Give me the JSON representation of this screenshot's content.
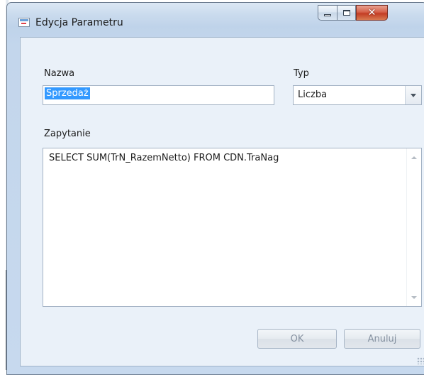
{
  "window": {
    "title": "Edycja Parametru",
    "buttons": {
      "minimize_icon": "minimize-icon",
      "maximize_icon": "maximize-icon",
      "close_icon": "close-icon"
    }
  },
  "form": {
    "name_label": "Nazwa",
    "name_value": "Sprzedaż",
    "type_label": "Typ",
    "type_value": "Liczba",
    "query_label": "Zapytanie",
    "query_value": "SELECT SUM(TrN_RazemNetto) FROM CDN.TraNag"
  },
  "actions": {
    "ok_label": "OK",
    "cancel_label": "Anuluj"
  },
  "colors": {
    "selection": "#3399ff",
    "client_background": "#eaf1f9",
    "close_button": "#c33d24"
  }
}
